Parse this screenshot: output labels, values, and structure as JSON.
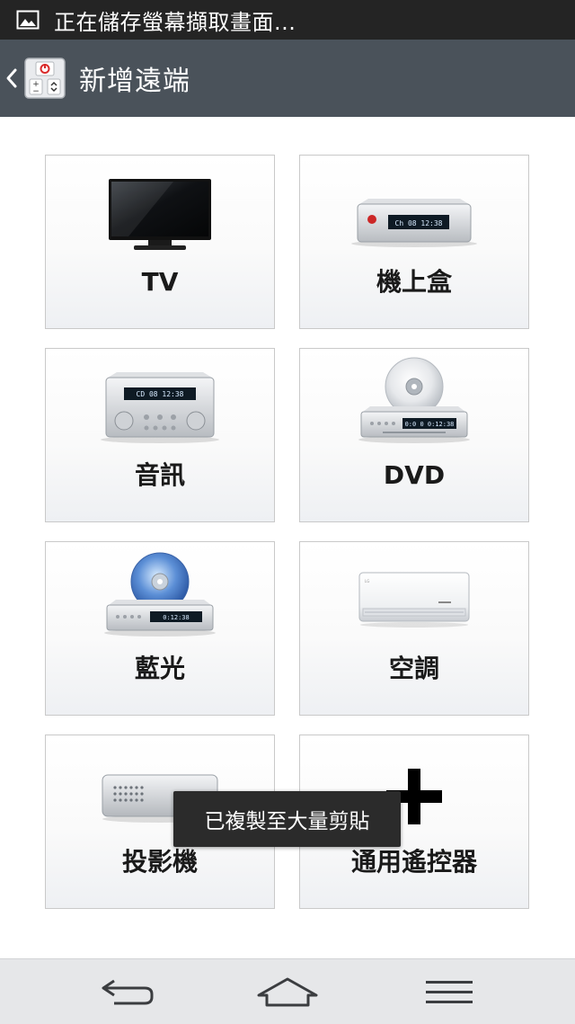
{
  "status_bar": {
    "notification_icon": "image-icon",
    "text": "正在儲存螢幕擷取畫面..."
  },
  "action_bar": {
    "back_icon": "chevron-left-icon",
    "app_icon": "remote-control-icon",
    "title": "新增遠端"
  },
  "devices": [
    {
      "label": "TV",
      "icon": "tv-icon"
    },
    {
      "label": "機上盒",
      "icon": "set-top-box-icon",
      "display": "Ch 08  12:38"
    },
    {
      "label": "音訊",
      "icon": "audio-receiver-icon",
      "display": "CD 08  12:38"
    },
    {
      "label": "DVD",
      "icon": "dvd-player-icon",
      "display": "0:0 0  0:12:38"
    },
    {
      "label": "藍光",
      "icon": "bluray-player-icon",
      "display": "0:12:38"
    },
    {
      "label": "空調",
      "icon": "air-conditioner-icon"
    },
    {
      "label": "投影機",
      "icon": "projector-icon"
    },
    {
      "label": "通用遙控器",
      "icon": "plus-icon"
    }
  ],
  "toast": {
    "text": "已複製至大量剪貼"
  },
  "nav_bar": {
    "back": "back-arrow-icon",
    "home": "home-icon",
    "menu": "menu-icon"
  }
}
